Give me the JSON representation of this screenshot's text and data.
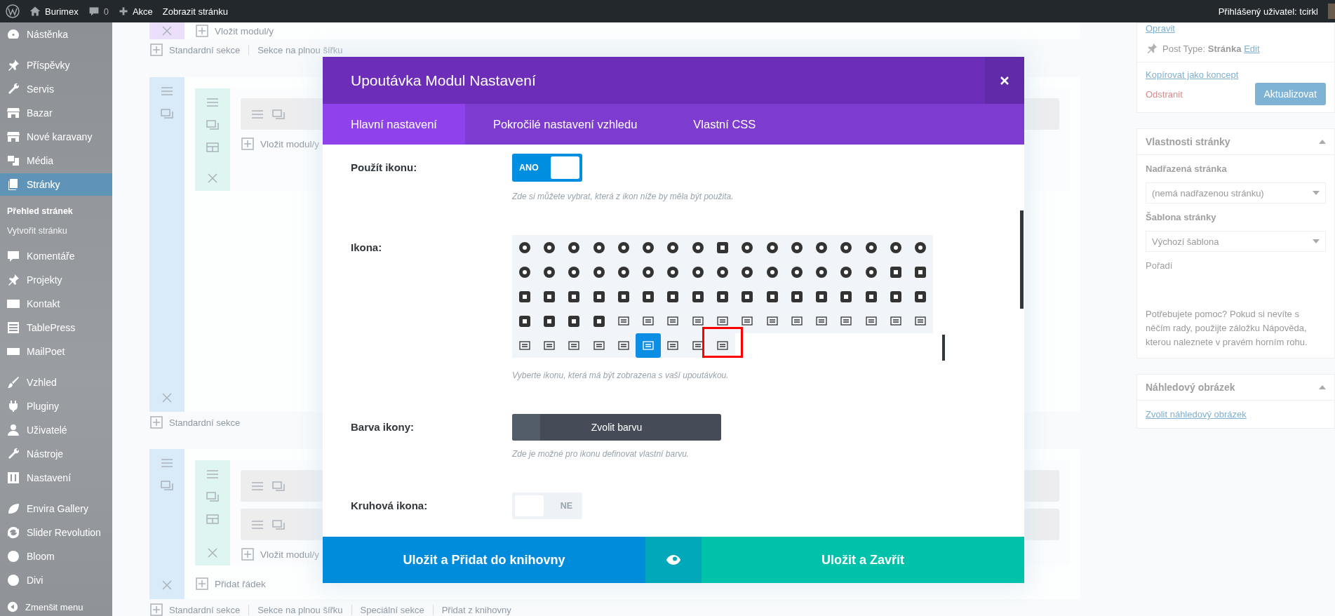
{
  "admin_bar": {
    "site": "Burimex",
    "comments": "0",
    "new": "Akce",
    "view": "Zobrazit stránku",
    "user": "Přihlášený uživatel: tcirkl"
  },
  "sidebar": {
    "groups": [
      [
        {
          "label": "Nástěnka",
          "selected": false
        }
      ],
      [
        {
          "label": "Příspěvky",
          "selected": false
        },
        {
          "label": "Servis",
          "selected": false
        },
        {
          "label": "Bazar",
          "selected": false
        },
        {
          "label": "Nové karavany",
          "selected": false
        },
        {
          "label": "Média",
          "selected": false
        },
        {
          "label": "Stránky",
          "selected": true,
          "submenu": [
            {
              "label": "Přehled stránek",
              "selected": true
            },
            {
              "label": "Vytvořit stránku",
              "selected": false
            }
          ]
        },
        {
          "label": "Komentáře",
          "selected": false
        },
        {
          "label": "Projekty",
          "selected": false
        },
        {
          "label": "Kontakt",
          "selected": false
        },
        {
          "label": "TablePress",
          "selected": false
        },
        {
          "label": "MailPoet",
          "selected": false
        }
      ],
      [
        {
          "label": "Vzhled",
          "selected": false
        },
        {
          "label": "Pluginy",
          "selected": false
        },
        {
          "label": "Uživatelé",
          "selected": false
        },
        {
          "label": "Nástroje",
          "selected": false
        },
        {
          "label": "Nastavení",
          "selected": false
        }
      ],
      [
        {
          "label": "Envira Gallery",
          "selected": false
        },
        {
          "label": "Slider Revolution",
          "selected": false
        },
        {
          "label": "Bloom",
          "selected": false
        },
        {
          "label": "Divi",
          "selected": false
        }
      ]
    ],
    "collapse": "Zmenšit menu"
  },
  "builder": {
    "sections": [
      {
        "color": "#ecdffb",
        "insert": "Vložit modul/y",
        "links": [
          "Standardní sekce",
          "Sekce na plnou šířku"
        ]
      },
      {
        "color": "#d9eaf8",
        "rows": [
          {
            "modules": [
              {
                "kind": "module"
              }
            ],
            "insert": "Vložit modul/y"
          }
        ],
        "links": [
          "Standardní sekce"
        ]
      },
      {
        "color": "#d9eaf8",
        "rows": [
          {
            "modules": [
              {
                "kind": "module"
              },
              {
                "kind": "module"
              }
            ],
            "insert": "Vložit modul/y"
          }
        ],
        "add_row": "Přidat řádek",
        "links": [
          "Standardní sekce",
          "Sekce na plnou šířku",
          "Speciální sekce",
          "Přidat z knihovny"
        ]
      }
    ]
  },
  "side_panel": {
    "publish": {
      "edit_link": "Opravit",
      "post_type": "Post Type: **Stránka**",
      "post_type_edit": "Edit",
      "copy_link": "Kopírovat jako koncept",
      "delete_link": "Odstranit",
      "update_button": "Aktualizovat"
    },
    "boxes": [
      {
        "kind": "attributes",
        "title": "Vlastnosti stránky",
        "expanded": true,
        "fields": [
          {
            "label": "Nadřazená stránka",
            "value": "(nemá nadřazenou stránku)"
          },
          {
            "label": "Šablona stránky",
            "value": "Výchozí šablona"
          }
        ],
        "order_label": "Pořadí",
        "help": "Potřebujete pomoc? Pokud si nevíte s něčím rady, použijte záložku Nápověda, kterou naleznete v pravém horním rohu."
      },
      {
        "kind": "thumbnail",
        "title": "Náhledový obrázek",
        "expanded": true,
        "link": "Zvolit náhledový obrázek"
      }
    ]
  },
  "modal": {
    "title": "Upoutávka Modul Nastavení",
    "tabs": [
      {
        "label": "Hlavní nastavení",
        "selected": true
      },
      {
        "label": "Pokročilé nastavení vzhledu",
        "selected": false
      },
      {
        "label": "Vlastní CSS",
        "selected": false
      }
    ],
    "settings": [
      {
        "kind": "toggle",
        "label": "Použít ikonu:",
        "on": true,
        "text": "ANO",
        "description": "Zde si můžete vybrat, která z ikon níže by měla být použita."
      },
      {
        "kind": "icon_picker",
        "label": "Ikona:",
        "description": "Vyberte ikonu, která má být zobrazena s vaší upoutávkou.",
        "icons": [
          {
            "kind": "round",
            "selected": false,
            "highlighted": false
          },
          {
            "kind": "round",
            "selected": false,
            "highlighted": false
          },
          {
            "kind": "round",
            "selected": false,
            "highlighted": false
          },
          {
            "kind": "round",
            "selected": false,
            "highlighted": false
          },
          {
            "kind": "round",
            "selected": false,
            "highlighted": false
          },
          {
            "kind": "round",
            "selected": false,
            "highlighted": false
          },
          {
            "kind": "round",
            "selected": false,
            "highlighted": false
          },
          {
            "kind": "round",
            "selected": false,
            "highlighted": false
          },
          {
            "kind": "square",
            "selected": false,
            "highlighted": false
          },
          {
            "kind": "round",
            "selected": false,
            "highlighted": false
          },
          {
            "kind": "round",
            "selected": false,
            "highlighted": false
          },
          {
            "kind": "round",
            "selected": false,
            "highlighted": false
          },
          {
            "kind": "round",
            "selected": false,
            "highlighted": false
          },
          {
            "kind": "round",
            "selected": false,
            "highlighted": false
          },
          {
            "kind": "round",
            "selected": false,
            "highlighted": false
          },
          {
            "kind": "round",
            "selected": false,
            "highlighted": false
          },
          {
            "kind": "round",
            "selected": false,
            "highlighted": false
          },
          {
            "kind": "round",
            "selected": false,
            "highlighted": false
          },
          {
            "kind": "round",
            "selected": false,
            "highlighted": false
          },
          {
            "kind": "round",
            "selected": false,
            "highlighted": false
          },
          {
            "kind": "round",
            "selected": false,
            "highlighted": false
          },
          {
            "kind": "round",
            "selected": false,
            "highlighted": false
          },
          {
            "kind": "round",
            "selected": false,
            "highlighted": false
          },
          {
            "kind": "round",
            "selected": false,
            "highlighted": false
          },
          {
            "kind": "round",
            "selected": false,
            "highlighted": false
          },
          {
            "kind": "round",
            "selected": false,
            "highlighted": false
          },
          {
            "kind": "round",
            "selected": false,
            "highlighted": false
          },
          {
            "kind": "round",
            "selected": false,
            "highlighted": false
          },
          {
            "kind": "round",
            "selected": false,
            "highlighted": false
          },
          {
            "kind": "round",
            "selected": false,
            "highlighted": false
          },
          {
            "kind": "round",
            "selected": false,
            "highlighted": false
          },
          {
            "kind": "round",
            "selected": false,
            "highlighted": false
          },
          {
            "kind": "square",
            "selected": false,
            "highlighted": false
          },
          {
            "kind": "square",
            "selected": false,
            "highlighted": false
          },
          {
            "kind": "square",
            "selected": false,
            "highlighted": false
          },
          {
            "kind": "square",
            "selected": false,
            "highlighted": false
          },
          {
            "kind": "square",
            "selected": false,
            "highlighted": false
          },
          {
            "kind": "square",
            "selected": false,
            "highlighted": false
          },
          {
            "kind": "square",
            "selected": false,
            "highlighted": false
          },
          {
            "kind": "square",
            "selected": false,
            "highlighted": false
          },
          {
            "kind": "square",
            "selected": false,
            "highlighted": false
          },
          {
            "kind": "square",
            "selected": false,
            "highlighted": false
          },
          {
            "kind": "square",
            "selected": false,
            "highlighted": false
          },
          {
            "kind": "square",
            "selected": false,
            "highlighted": false
          },
          {
            "kind": "square",
            "selected": false,
            "highlighted": false
          },
          {
            "kind": "square",
            "selected": false,
            "highlighted": false
          },
          {
            "kind": "square",
            "selected": false,
            "highlighted": false
          },
          {
            "kind": "square",
            "selected": false,
            "highlighted": false
          },
          {
            "kind": "square",
            "selected": false,
            "highlighted": false
          },
          {
            "kind": "square",
            "selected": false,
            "highlighted": false
          },
          {
            "kind": "square",
            "selected": false,
            "highlighted": false
          },
          {
            "kind": "square",
            "selected": false,
            "highlighted": false
          },
          {
            "kind": "square",
            "selected": false,
            "highlighted": false
          },
          {
            "kind": "square",
            "selected": false,
            "highlighted": false
          },
          {
            "kind": "square",
            "selected": false,
            "highlighted": false
          },
          {
            "kind": "line",
            "selected": false,
            "highlighted": false
          },
          {
            "kind": "line",
            "selected": false,
            "highlighted": false
          },
          {
            "kind": "line",
            "selected": false,
            "highlighted": false
          },
          {
            "kind": "line",
            "selected": false,
            "highlighted": false
          },
          {
            "kind": "line",
            "selected": false,
            "highlighted": false
          },
          {
            "kind": "line",
            "selected": false,
            "highlighted": false
          },
          {
            "kind": "line",
            "selected": false,
            "highlighted": false
          },
          {
            "kind": "line",
            "selected": false,
            "highlighted": false
          },
          {
            "kind": "line",
            "selected": false,
            "highlighted": false
          },
          {
            "kind": "line",
            "selected": false,
            "highlighted": false
          },
          {
            "kind": "line",
            "selected": false,
            "highlighted": false
          },
          {
            "kind": "line",
            "selected": false,
            "highlighted": false
          },
          {
            "kind": "line",
            "selected": false,
            "highlighted": false
          },
          {
            "kind": "line",
            "selected": false,
            "highlighted": false
          },
          {
            "kind": "line",
            "selected": false,
            "highlighted": false
          },
          {
            "kind": "line",
            "selected": false,
            "highlighted": false
          },
          {
            "kind": "line",
            "selected": false,
            "highlighted": false
          },
          {
            "kind": "line",
            "selected": false,
            "highlighted": false
          },
          {
            "kind": "line",
            "selected": true,
            "highlighted": false
          },
          {
            "kind": "line",
            "selected": false,
            "highlighted": false
          },
          {
            "kind": "line",
            "selected": false,
            "highlighted": false
          },
          {
            "kind": "line",
            "selected": false,
            "highlighted": true
          }
        ]
      },
      {
        "kind": "color_button",
        "label": "Barva ikony:",
        "button": "Zvolit barvu",
        "description": "Zde je možné pro ikonu definovat vlastní barvu."
      },
      {
        "kind": "toggle",
        "label": "Kruhová ikona:",
        "on": false,
        "text": "NE"
      }
    ],
    "footer": {
      "save_library": "Uložit a Přidat do knihovny",
      "save_close": "Uložit a Zavřít"
    }
  }
}
